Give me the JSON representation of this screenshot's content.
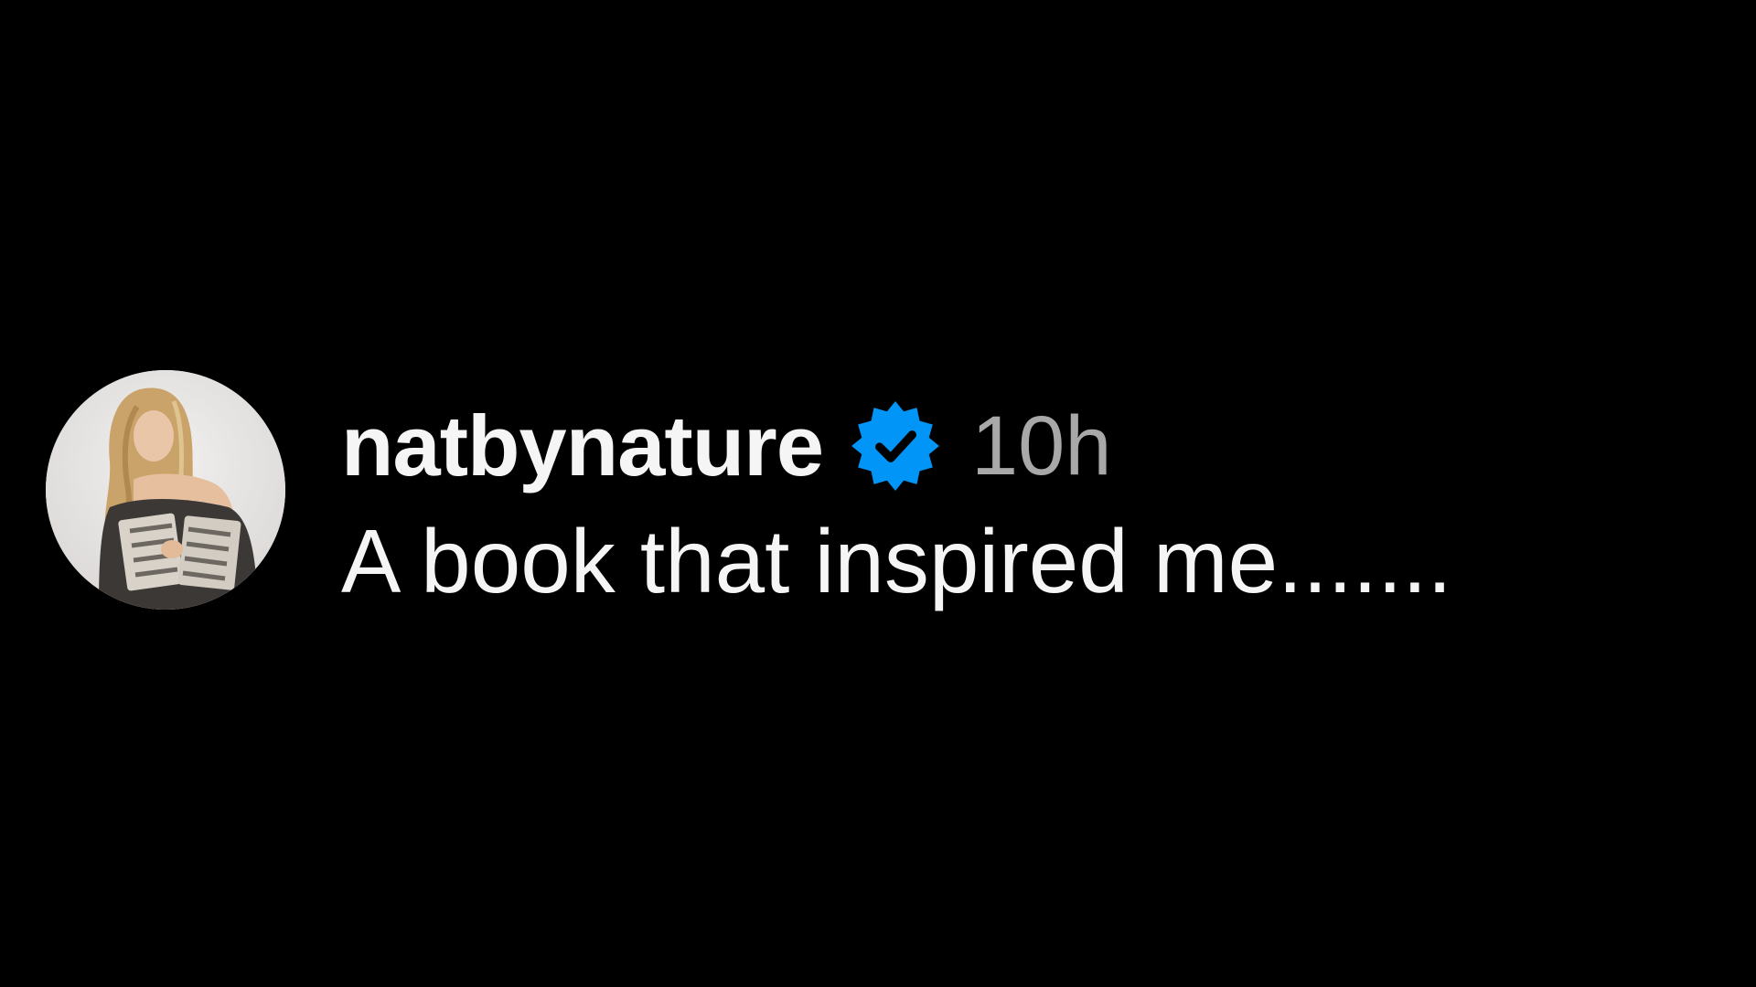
{
  "comment": {
    "username": "natbynature",
    "verified": true,
    "verified_badge_icon": "verified-check-icon",
    "timestamp": "10h",
    "text": "A book that inspired me.......",
    "avatar_icon": "profile-photo-avatar"
  },
  "colors": {
    "background": "#000000",
    "primary_text": "#f5f5f5",
    "secondary_text": "#a8a8a8",
    "verified_blue": "#0095f6"
  }
}
